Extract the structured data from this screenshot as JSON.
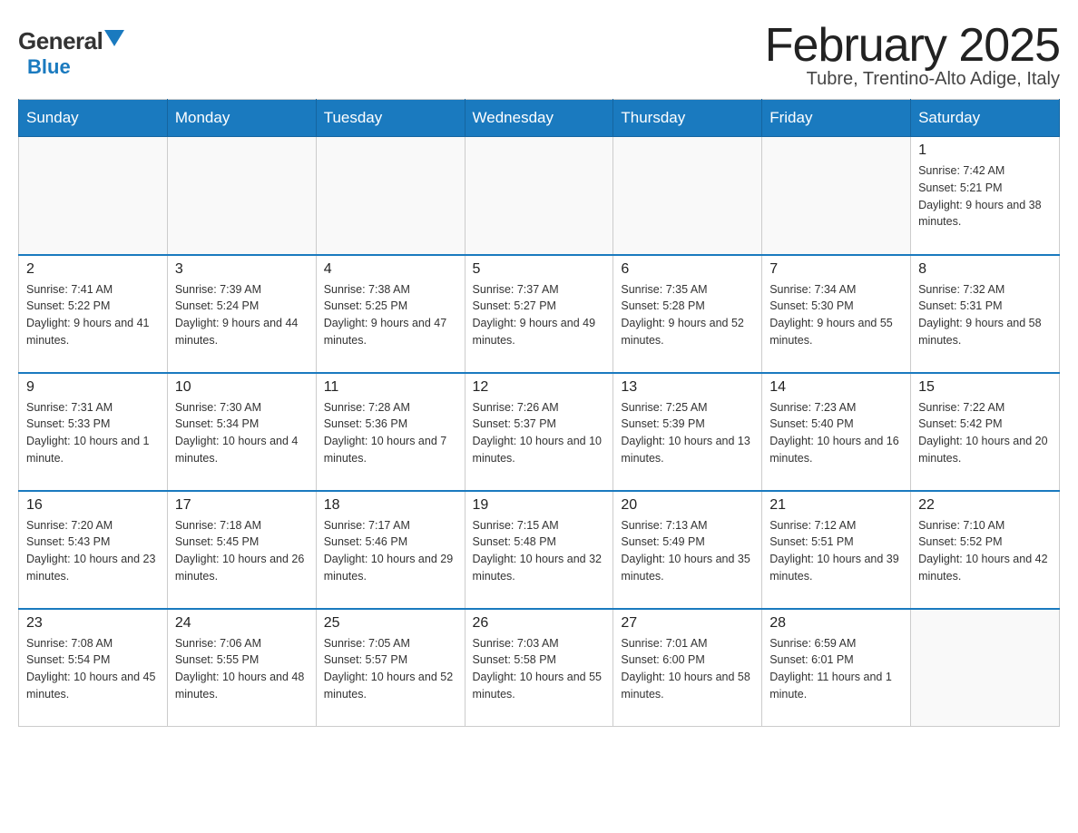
{
  "header": {
    "logo_general": "General",
    "logo_blue": "Blue",
    "month_title": "February 2025",
    "location": "Tubre, Trentino-Alto Adige, Italy"
  },
  "days_of_week": [
    "Sunday",
    "Monday",
    "Tuesday",
    "Wednesday",
    "Thursday",
    "Friday",
    "Saturday"
  ],
  "weeks": [
    [
      {
        "day": "",
        "sunrise": "",
        "sunset": "",
        "daylight": ""
      },
      {
        "day": "",
        "sunrise": "",
        "sunset": "",
        "daylight": ""
      },
      {
        "day": "",
        "sunrise": "",
        "sunset": "",
        "daylight": ""
      },
      {
        "day": "",
        "sunrise": "",
        "sunset": "",
        "daylight": ""
      },
      {
        "day": "",
        "sunrise": "",
        "sunset": "",
        "daylight": ""
      },
      {
        "day": "",
        "sunrise": "",
        "sunset": "",
        "daylight": ""
      },
      {
        "day": "1",
        "sunrise": "Sunrise: 7:42 AM",
        "sunset": "Sunset: 5:21 PM",
        "daylight": "Daylight: 9 hours and 38 minutes."
      }
    ],
    [
      {
        "day": "2",
        "sunrise": "Sunrise: 7:41 AM",
        "sunset": "Sunset: 5:22 PM",
        "daylight": "Daylight: 9 hours and 41 minutes."
      },
      {
        "day": "3",
        "sunrise": "Sunrise: 7:39 AM",
        "sunset": "Sunset: 5:24 PM",
        "daylight": "Daylight: 9 hours and 44 minutes."
      },
      {
        "day": "4",
        "sunrise": "Sunrise: 7:38 AM",
        "sunset": "Sunset: 5:25 PM",
        "daylight": "Daylight: 9 hours and 47 minutes."
      },
      {
        "day": "5",
        "sunrise": "Sunrise: 7:37 AM",
        "sunset": "Sunset: 5:27 PM",
        "daylight": "Daylight: 9 hours and 49 minutes."
      },
      {
        "day": "6",
        "sunrise": "Sunrise: 7:35 AM",
        "sunset": "Sunset: 5:28 PM",
        "daylight": "Daylight: 9 hours and 52 minutes."
      },
      {
        "day": "7",
        "sunrise": "Sunrise: 7:34 AM",
        "sunset": "Sunset: 5:30 PM",
        "daylight": "Daylight: 9 hours and 55 minutes."
      },
      {
        "day": "8",
        "sunrise": "Sunrise: 7:32 AM",
        "sunset": "Sunset: 5:31 PM",
        "daylight": "Daylight: 9 hours and 58 minutes."
      }
    ],
    [
      {
        "day": "9",
        "sunrise": "Sunrise: 7:31 AM",
        "sunset": "Sunset: 5:33 PM",
        "daylight": "Daylight: 10 hours and 1 minute."
      },
      {
        "day": "10",
        "sunrise": "Sunrise: 7:30 AM",
        "sunset": "Sunset: 5:34 PM",
        "daylight": "Daylight: 10 hours and 4 minutes."
      },
      {
        "day": "11",
        "sunrise": "Sunrise: 7:28 AM",
        "sunset": "Sunset: 5:36 PM",
        "daylight": "Daylight: 10 hours and 7 minutes."
      },
      {
        "day": "12",
        "sunrise": "Sunrise: 7:26 AM",
        "sunset": "Sunset: 5:37 PM",
        "daylight": "Daylight: 10 hours and 10 minutes."
      },
      {
        "day": "13",
        "sunrise": "Sunrise: 7:25 AM",
        "sunset": "Sunset: 5:39 PM",
        "daylight": "Daylight: 10 hours and 13 minutes."
      },
      {
        "day": "14",
        "sunrise": "Sunrise: 7:23 AM",
        "sunset": "Sunset: 5:40 PM",
        "daylight": "Daylight: 10 hours and 16 minutes."
      },
      {
        "day": "15",
        "sunrise": "Sunrise: 7:22 AM",
        "sunset": "Sunset: 5:42 PM",
        "daylight": "Daylight: 10 hours and 20 minutes."
      }
    ],
    [
      {
        "day": "16",
        "sunrise": "Sunrise: 7:20 AM",
        "sunset": "Sunset: 5:43 PM",
        "daylight": "Daylight: 10 hours and 23 minutes."
      },
      {
        "day": "17",
        "sunrise": "Sunrise: 7:18 AM",
        "sunset": "Sunset: 5:45 PM",
        "daylight": "Daylight: 10 hours and 26 minutes."
      },
      {
        "day": "18",
        "sunrise": "Sunrise: 7:17 AM",
        "sunset": "Sunset: 5:46 PM",
        "daylight": "Daylight: 10 hours and 29 minutes."
      },
      {
        "day": "19",
        "sunrise": "Sunrise: 7:15 AM",
        "sunset": "Sunset: 5:48 PM",
        "daylight": "Daylight: 10 hours and 32 minutes."
      },
      {
        "day": "20",
        "sunrise": "Sunrise: 7:13 AM",
        "sunset": "Sunset: 5:49 PM",
        "daylight": "Daylight: 10 hours and 35 minutes."
      },
      {
        "day": "21",
        "sunrise": "Sunrise: 7:12 AM",
        "sunset": "Sunset: 5:51 PM",
        "daylight": "Daylight: 10 hours and 39 minutes."
      },
      {
        "day": "22",
        "sunrise": "Sunrise: 7:10 AM",
        "sunset": "Sunset: 5:52 PM",
        "daylight": "Daylight: 10 hours and 42 minutes."
      }
    ],
    [
      {
        "day": "23",
        "sunrise": "Sunrise: 7:08 AM",
        "sunset": "Sunset: 5:54 PM",
        "daylight": "Daylight: 10 hours and 45 minutes."
      },
      {
        "day": "24",
        "sunrise": "Sunrise: 7:06 AM",
        "sunset": "Sunset: 5:55 PM",
        "daylight": "Daylight: 10 hours and 48 minutes."
      },
      {
        "day": "25",
        "sunrise": "Sunrise: 7:05 AM",
        "sunset": "Sunset: 5:57 PM",
        "daylight": "Daylight: 10 hours and 52 minutes."
      },
      {
        "day": "26",
        "sunrise": "Sunrise: 7:03 AM",
        "sunset": "Sunset: 5:58 PM",
        "daylight": "Daylight: 10 hours and 55 minutes."
      },
      {
        "day": "27",
        "sunrise": "Sunrise: 7:01 AM",
        "sunset": "Sunset: 6:00 PM",
        "daylight": "Daylight: 10 hours and 58 minutes."
      },
      {
        "day": "28",
        "sunrise": "Sunrise: 6:59 AM",
        "sunset": "Sunset: 6:01 PM",
        "daylight": "Daylight: 11 hours and 1 minute."
      },
      {
        "day": "",
        "sunrise": "",
        "sunset": "",
        "daylight": ""
      }
    ]
  ]
}
